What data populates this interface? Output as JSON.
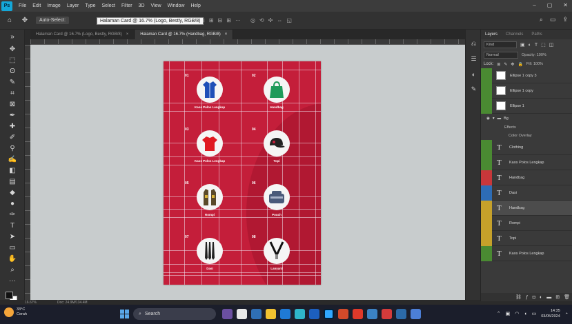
{
  "menubar": {
    "logo": "Ps",
    "items": [
      "File",
      "Edit",
      "Image",
      "Layer",
      "Type",
      "Select",
      "Filter",
      "3D",
      "View",
      "Window",
      "Help"
    ]
  },
  "options": {
    "auto_select_label": "Auto-Select:",
    "tooltip": "Halaman Card @ 16.7% (Logo, Bestly, RGB/8)"
  },
  "tabs": [
    {
      "label": "Halaman Card @ 16.7% (Logo, Bestly, RGB/8)",
      "close": "×"
    },
    {
      "label": "Halaman Card @ 16.7% (Handbag, RGB/8)",
      "close": "×"
    }
  ],
  "poster": {
    "background": "#c41e3a",
    "items": [
      {
        "number": "01",
        "caption": "Kaos Polos Lengkap",
        "icon": "shirt-icon",
        "color": "#1e4fb8"
      },
      {
        "number": "02",
        "caption": "Handbag",
        "icon": "bag-icon",
        "color": "#1e9a5a"
      },
      {
        "number": "03",
        "caption": "Kaos Polos Lengkap",
        "icon": "tshirt-icon",
        "color": "#e01a22"
      },
      {
        "number": "04",
        "caption": "Topi",
        "icon": "cap-icon",
        "color": "#222222"
      },
      {
        "number": "05",
        "caption": "Rompi",
        "icon": "vest-icon",
        "color": "#5a4a2a"
      },
      {
        "number": "06",
        "caption": "Pouch",
        "icon": "pouch-icon",
        "color": "#4a5a7a"
      },
      {
        "number": "07",
        "caption": "Dasi",
        "icon": "tie-icon",
        "color": "#222222"
      },
      {
        "number": "08",
        "caption": "Lanyard",
        "icon": "lanyard-icon",
        "color": "#111111"
      }
    ]
  },
  "layers_panel": {
    "tabs": [
      "Layers",
      "Channels",
      "Paths"
    ],
    "filter_label": "Kind",
    "blend_mode": "Normal",
    "opacity_label": "Opacity: 100%",
    "lock_label": "Lock:",
    "fill_label": "Fill: 100%",
    "layers": [
      {
        "type": "image",
        "name": "Ellipse 1 copy 3",
        "color": "#4a8a32"
      },
      {
        "type": "image",
        "name": "Ellipse 1 copy",
        "color": "#4a8a32"
      },
      {
        "type": "image",
        "name": "Ellipse 1",
        "color": "#4a8a32"
      }
    ],
    "group": {
      "name": "Bg",
      "effects_label": "Effects",
      "effect": "Color Overlay"
    },
    "text_layers": [
      {
        "name": "Clothing",
        "color": "#4a8a32"
      },
      {
        "name": "Kaos Polos Lengkap",
        "color": "#4a8a32"
      },
      {
        "name": "Handbag",
        "color": "#c8373a"
      },
      {
        "name": "Dasi",
        "color": "#2d6cb5"
      },
      {
        "name": "Handbag",
        "color": "#c6a12a",
        "selected": true
      },
      {
        "name": "Rompi",
        "color": "#c6a12a"
      },
      {
        "name": "Topi",
        "color": "#c6a12a"
      },
      {
        "name": "Kaos Polos Lengkap",
        "color": "#4a8a32"
      }
    ]
  },
  "statusbar": {
    "zoom": "16.67%",
    "doc": "Doc: 24.9M/134.4M"
  },
  "taskbar": {
    "temp": "33°C",
    "weather": "Cerah",
    "search": "Search",
    "time": "14:35",
    "date": "03/05/2024"
  }
}
